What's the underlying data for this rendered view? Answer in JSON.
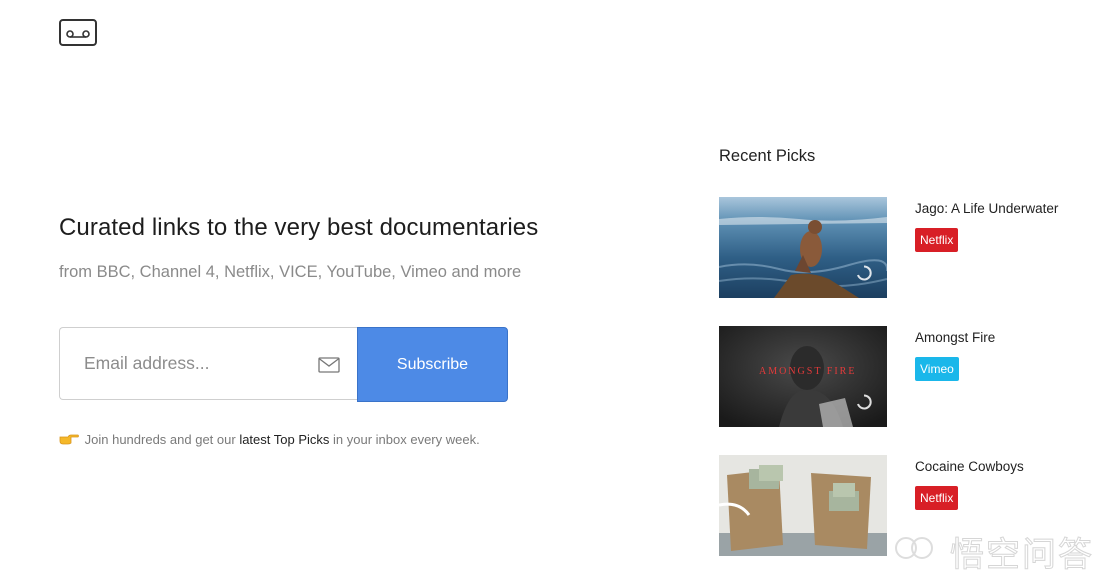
{
  "brand": {
    "logo_icon": "cassette-tape-icon"
  },
  "hero": {
    "title": "Curated links to the very best documentaries",
    "subtitle": "from BBC, Channel 4, Netflix, VICE, YouTube, Vimeo and more"
  },
  "subscribe": {
    "email_placeholder": "Email address...",
    "email_value": "",
    "mail_icon": "envelope-icon",
    "button_label": "Subscribe",
    "accent_color": "#4d8ae6"
  },
  "note": {
    "emoji_icon": "pointing-hand-icon",
    "prefix": "Join hundreds and get our",
    "link_text": "latest Top Picks",
    "suffix": "in your inbox every week."
  },
  "recent": {
    "heading": "Recent Picks",
    "items": [
      {
        "title": "Jago: A Life Underwater",
        "badge": "Netflix",
        "badge_color": "#d81f26",
        "thumb_icon": "play-spinner-icon"
      },
      {
        "title": "Amongst Fire",
        "badge": "Vimeo",
        "badge_color": "#1ab7ea",
        "thumb_text": "AMONGST FIRE",
        "thumb_icon": "play-spinner-icon"
      },
      {
        "title": "Cocaine Cowboys",
        "badge": "Netflix",
        "badge_color": "#d81f26"
      }
    ]
  },
  "watermark": {
    "text": "悟空问答"
  }
}
